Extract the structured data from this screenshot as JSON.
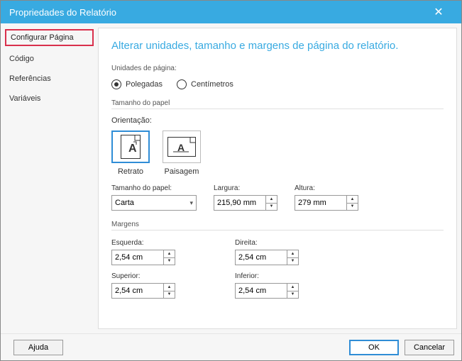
{
  "titlebar": {
    "title": "Propriedades do Relatório"
  },
  "sidebar": {
    "items": [
      {
        "label": "Configurar Página",
        "active": true
      },
      {
        "label": "Código"
      },
      {
        "label": "Referências"
      },
      {
        "label": "Variáveis"
      }
    ]
  },
  "content": {
    "heading": "Alterar unidades, tamanho e margens de página do relatório.",
    "units": {
      "label": "Unidades de página:",
      "options": {
        "inches": "Polegadas",
        "centimeters": "Centímetros"
      },
      "selected": "inches"
    },
    "paperSize": {
      "sectionLabel": "Tamanho do papel",
      "orientationLabel": "Orientação:",
      "orientation": {
        "portrait": "Retrato",
        "landscape": "Paisagem",
        "selected": "portrait"
      },
      "paperLabel": "Tamanho do papel:",
      "paperValue": "Carta",
      "widthLabel": "Largura:",
      "widthValue": "215,90 mm",
      "heightLabel": "Altura:",
      "heightValue": "279 mm"
    },
    "margins": {
      "sectionLabel": "Margens",
      "leftLabel": "Esquerda:",
      "leftValue": "2,54 cm",
      "rightLabel": "Direita:",
      "rightValue": "2,54 cm",
      "topLabel": "Superior:",
      "topValue": "2,54 cm",
      "bottomLabel": "Inferior:",
      "bottomValue": "2,54 cm"
    }
  },
  "footer": {
    "help": "Ajuda",
    "ok": "OK",
    "cancel": "Cancelar"
  }
}
